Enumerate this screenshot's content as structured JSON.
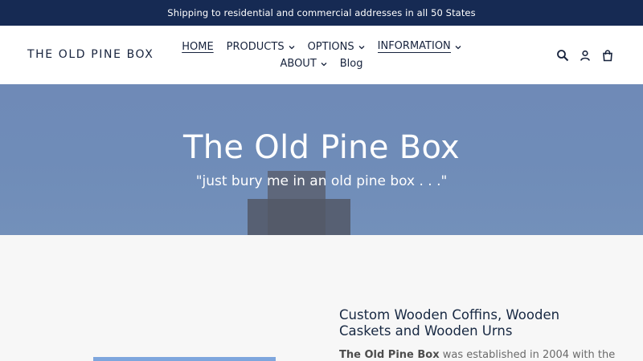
{
  "announcement": "Shipping to residential and commercial addresses in all 50 States",
  "logo": "THE OLD PINE BOX",
  "nav": {
    "row1": [
      {
        "label": "HOME"
      },
      {
        "label": "PRODUCTS"
      },
      {
        "label": "OPTIONS"
      },
      {
        "label": "INFORMATION"
      }
    ],
    "row2": [
      {
        "label": "ABOUT"
      },
      {
        "label": "Blog"
      }
    ]
  },
  "header_icons": [
    "search-icon",
    "account-icon",
    "cart-icon"
  ],
  "hero": {
    "title": "The Old Pine Box",
    "subtitle": "\"just bury me in an old pine box . . .\""
  },
  "content": {
    "heading": "Custom Wooden Coffins, Wooden Caskets and Wooden Urns",
    "text_bold": "The Old Pine Box",
    "text_rest": " was established in 2004 with the"
  },
  "colors": {
    "announcement_bg": "#162a53",
    "text_dark": "#17233d",
    "hero_bg": "#6f8ab7"
  }
}
